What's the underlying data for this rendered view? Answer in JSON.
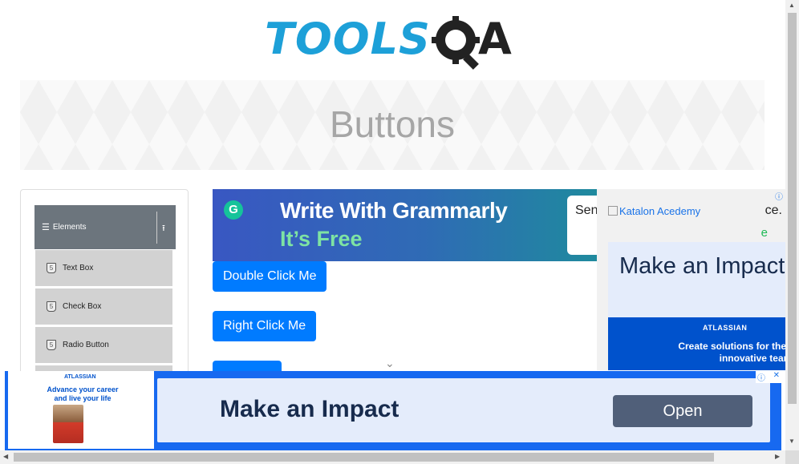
{
  "logo": {
    "brand_left": "TOOLS",
    "brand_right": "A",
    "gear_icon": "gear-magnifier-icon"
  },
  "banner": {
    "title": "Buttons"
  },
  "sidebar": {
    "group_label": "Elements",
    "group_icon": "hamburger-icon",
    "collapse_icon": "arrow-up-icon",
    "items": [
      {
        "label": "Text Box",
        "icon": "html5-icon"
      },
      {
        "label": "Check Box",
        "icon": "html5-icon"
      },
      {
        "label": "Radio Button",
        "icon": "html5-icon"
      }
    ]
  },
  "ad_grammarly": {
    "line1": "Write With Grammarly",
    "line2": "It’s Free",
    "card_text": "Sen",
    "logo_letter": "G"
  },
  "buttons": {
    "double_click": "Double Click Me",
    "right_click": "Right Click Me"
  },
  "ad_right": {
    "broken_image_alt": "Katalon Acedemy",
    "partial_text": "ce.",
    "partial_e": "e",
    "info": "ⓘ",
    "impact_title": "Make an Impact",
    "atlassian_name": "ATLASSIAN",
    "atlassian_tagline": "Create solutions for the m innovative teams"
  },
  "ad_bottom": {
    "thumb_logo": "ATLASSIAN",
    "thumb_headline": "Advance your career and live your life",
    "headline": "Make an Impact",
    "open_label": "Open",
    "info": "ⓘ",
    "close": "✕"
  },
  "colors": {
    "primary": "#007bff",
    "sidebar_header": "#6c757d",
    "ad_blue": "#1769f0"
  }
}
